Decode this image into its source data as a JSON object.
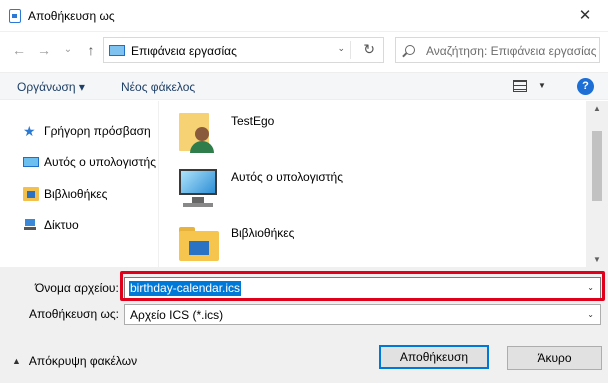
{
  "window": {
    "title": "Αποθήκευση ως",
    "close_glyph": "✕"
  },
  "navigation": {
    "back_glyph": "←",
    "forward_glyph": "→",
    "recent_glyph": "⌄",
    "up_glyph": "↑",
    "address": "Επιφάνεια εργασίας",
    "address_dropdown_glyph": "⌄",
    "refresh_glyph": "↻",
    "search_placeholder": "Αναζήτηση: Επιφάνεια εργασίας"
  },
  "toolbar": {
    "organize_label": "Οργάνωση ▾",
    "new_folder_label": "Νέος φάκελος",
    "view_dropdown_glyph": "▼",
    "help_glyph": "?"
  },
  "sidebar": {
    "items": [
      {
        "label": "Γρήγορη πρόσβαση",
        "icon": "star-icon"
      },
      {
        "label": "Αυτός ο υπολογιστής",
        "icon": "computer-icon"
      },
      {
        "label": "Βιβλιοθήκες",
        "icon": "libraries-icon"
      },
      {
        "label": "Δίκτυο",
        "icon": "network-icon"
      }
    ]
  },
  "files": [
    {
      "label": "TestEgo",
      "icon": "user-folder-icon"
    },
    {
      "label": "Αυτός ο υπολογιστής",
      "icon": "computer-icon"
    },
    {
      "label": "Βιβλιοθήκες",
      "icon": "libraries-folder-icon"
    }
  ],
  "scrollbar": {
    "up_glyph": "▲",
    "down_glyph": "▼"
  },
  "form": {
    "filename_label": "Όνομα αρχείου:",
    "filename_value": "birthday-calendar.ics",
    "savetype_label": "Αποθήκευση ως:",
    "savetype_value": "Αρχείο ICS (*.ics)",
    "dropdown_glyph": "⌄"
  },
  "footer": {
    "hide_folders_label": "Απόκρυψη φακέλων",
    "hide_folders_glyph": "▲",
    "save_label": "Αποθήκευση",
    "cancel_label": "Άκυρο"
  },
  "colors": {
    "accent": "#0078d7",
    "highlight": "#e0001b",
    "help": "#1d6ed5"
  }
}
